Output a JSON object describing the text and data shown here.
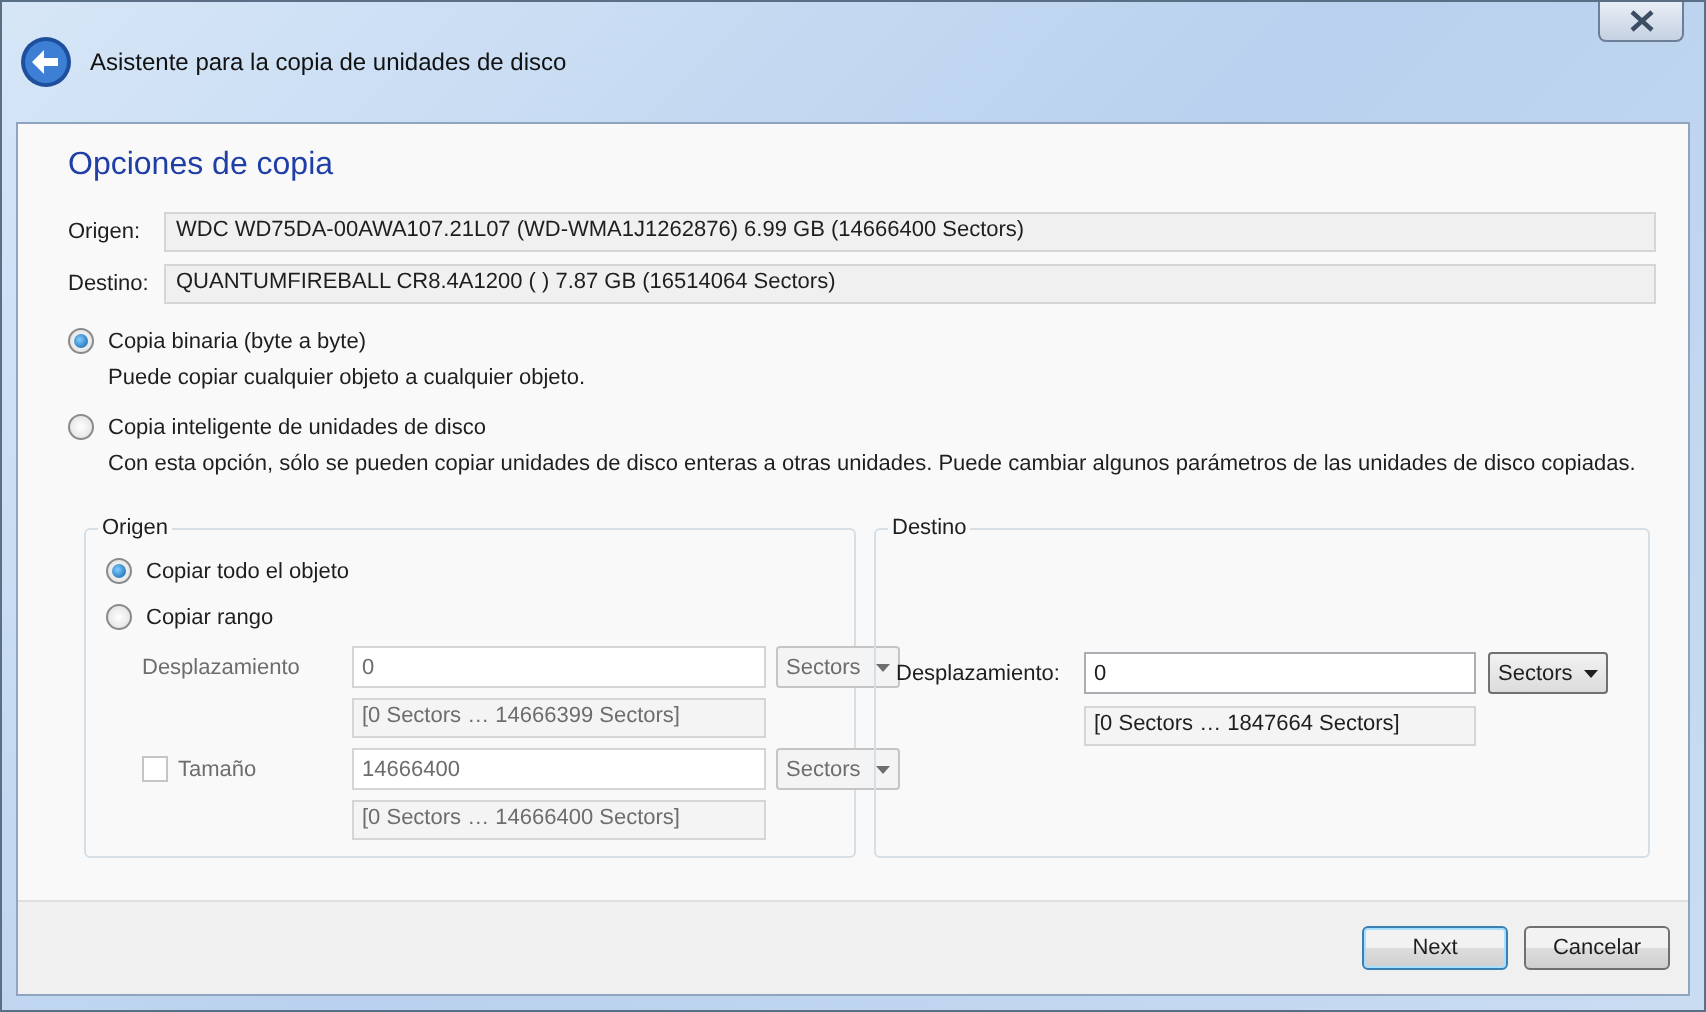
{
  "window": {
    "title": "Asistente para la copia de unidades de disco"
  },
  "heading": "Opciones de copia",
  "info_fields": [
    {
      "label": "Origen:",
      "value": "WDC WD75DA-00AWA107.21L07 (WD-WMA1J1262876) 6.99 GB (14666400 Sectors)"
    },
    {
      "label": "Destino:",
      "value": "QUANTUMFIREBALL CR8.4A1200 ( ) 7.87 GB (16514064 Sectors)"
    }
  ],
  "copy_modes": [
    {
      "label": "Copia binaria (byte a byte)",
      "selected": true,
      "description": "Puede copiar cualquier objeto a cualquier objeto."
    },
    {
      "label": "Copia inteligente de unidades de disco",
      "selected": false,
      "description": "Con esta opción, sólo se pueden copiar unidades de disco enteras a otras unidades. Puede cambiar algunos parámetros de las unidades de disco copiadas."
    }
  ],
  "source_group": {
    "title": "Origen",
    "options": [
      {
        "label": "Copiar todo el objeto",
        "selected": true
      },
      {
        "label": "Copiar rango",
        "selected": false
      }
    ],
    "offset": {
      "label": "Desplazamiento",
      "value": "0",
      "unit": "Sectors",
      "range": "[0 Sectors … 14666399 Sectors]",
      "disabled": true
    },
    "size": {
      "label": "Tamaño",
      "checked": false,
      "value": "14666400",
      "unit": "Sectors",
      "range": "[0 Sectors … 14666400 Sectors]",
      "disabled": true
    }
  },
  "destination_group": {
    "title": "Destino",
    "offset": {
      "label": "Desplazamiento:",
      "value": "0",
      "unit": "Sectors",
      "range": "[0 Sectors … 1847664 Sectors]",
      "disabled": false
    }
  },
  "buttons": [
    {
      "label": "Next",
      "default": true
    },
    {
      "label": "Cancelar",
      "default": false
    }
  ]
}
